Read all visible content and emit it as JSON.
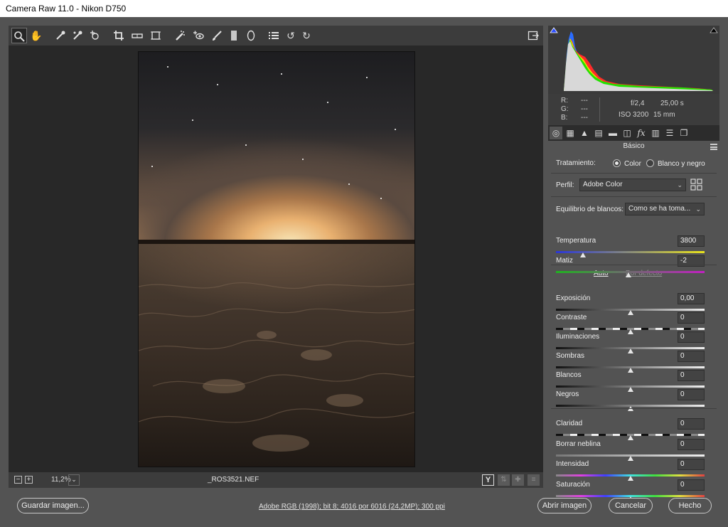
{
  "window": {
    "title": "Camera Raw 11.0 -  Nikon D750"
  },
  "toolbar": {
    "tools": [
      {
        "name": "zoom-tool",
        "icon": "magnifier-icon"
      },
      {
        "name": "hand-tool",
        "icon": "hand-icon"
      },
      {
        "name": "white-balance-tool",
        "icon": "eyedropper-icon"
      },
      {
        "name": "color-sampler-tool",
        "icon": "sampler-icon"
      },
      {
        "name": "targeted-adjustment-tool",
        "icon": "target-icon"
      },
      {
        "name": "crop-tool",
        "icon": "crop-icon"
      },
      {
        "name": "straighten-tool",
        "icon": "level-icon"
      },
      {
        "name": "transform-tool",
        "icon": "transform-icon"
      },
      {
        "name": "spot-removal-tool",
        "icon": "spot-icon"
      },
      {
        "name": "red-eye-tool",
        "icon": "red-eye-icon"
      },
      {
        "name": "adjustment-brush-tool",
        "icon": "brush-icon"
      },
      {
        "name": "graduated-filter-tool",
        "icon": "gradient-icon"
      },
      {
        "name": "radial-filter-tool",
        "icon": "ellipse-icon"
      },
      {
        "name": "preferences-tool",
        "icon": "list-icon"
      },
      {
        "name": "rotate-left-tool",
        "icon": "rotate-ccw-icon"
      },
      {
        "name": "rotate-right-tool",
        "icon": "rotate-cw-icon"
      }
    ],
    "fullscreen_icon": "fullscreen-icon"
  },
  "status": {
    "zoom": "11,2%",
    "filename": "_ROS3521.NEF",
    "y_toggle": "Y"
  },
  "readout": {
    "r_label": "R:",
    "g_label": "G:",
    "b_label": "B:",
    "r_val": "---",
    "g_val": "---",
    "b_val": "---",
    "aperture": "f/2,4",
    "shutter": "25,00 s",
    "iso": "ISO 3200",
    "focal": "15 mm"
  },
  "panel": {
    "section_title": "Básico",
    "treatment_label": "Tratamiento:",
    "color_option": "Color",
    "bw_option": "Blanco y negro",
    "profile_label": "Perfil:",
    "profile_value": "Adobe Color",
    "wb_label": "Equilibrio de blancos:",
    "wb_value": "Como se ha toma...",
    "auto_link": "Auto",
    "default_link": "Por defecto",
    "sliders": [
      {
        "label": "Temperatura",
        "value": "3800",
        "pos": 0.18
      },
      {
        "label": "Matiz",
        "value": "-2",
        "pos": 0.49
      },
      {
        "label": "Exposición",
        "value": "0,00",
        "pos": 0.5
      },
      {
        "label": "Contraste",
        "value": "0",
        "pos": 0.5
      },
      {
        "label": "Iluminaciones",
        "value": "0",
        "pos": 0.5
      },
      {
        "label": "Sombras",
        "value": "0",
        "pos": 0.5
      },
      {
        "label": "Blancos",
        "value": "0",
        "pos": 0.5
      },
      {
        "label": "Negros",
        "value": "0",
        "pos": 0.5
      },
      {
        "label": "Claridad",
        "value": "0",
        "pos": 0.5
      },
      {
        "label": "Borrar neblina",
        "value": "0",
        "pos": 0.5
      },
      {
        "label": "Intensidad",
        "value": "0",
        "pos": 0.5
      },
      {
        "label": "Saturación",
        "value": "0",
        "pos": 0.5
      }
    ]
  },
  "footer": {
    "save_label": "Guardar imagen...",
    "workflow_info": "Adobe RGB (1998); bit 8; 4016 por 6016 (24,2MP); 300 ppi",
    "open_label": "Abrir imagen",
    "cancel_label": "Cancelar",
    "done_label": "Hecho"
  },
  "colors": {
    "app_bg": "#535353",
    "panel_dark": "#3c3c3c",
    "preview_bg": "#282828",
    "link_active": "#e8e8e8",
    "link_inactive": "#8f8f8f"
  }
}
